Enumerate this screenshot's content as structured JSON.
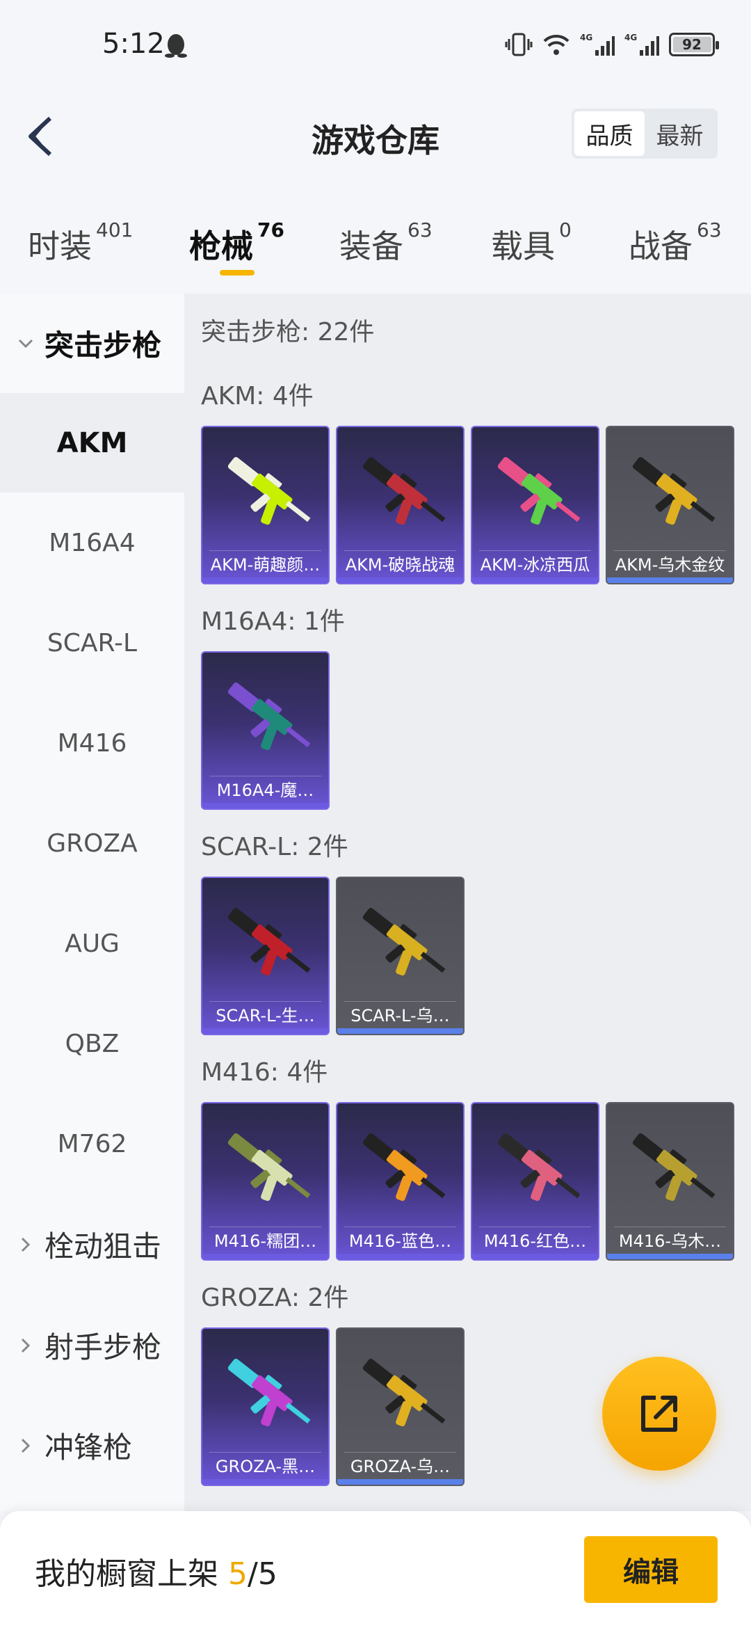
{
  "status": {
    "time": "5:12",
    "battery": "92"
  },
  "header": {
    "title": "游戏仓库",
    "sort_options": [
      "品质",
      "最新"
    ],
    "sort_active": "品质"
  },
  "tabs": [
    {
      "label": "时装",
      "count": "401"
    },
    {
      "label": "枪械",
      "count": "76"
    },
    {
      "label": "装备",
      "count": "63"
    },
    {
      "label": "载具",
      "count": "0"
    },
    {
      "label": "战备",
      "count": "63"
    }
  ],
  "sidebar": {
    "open_group": "突击步枪",
    "items": [
      "AKM",
      "M16A4",
      "SCAR-L",
      "M416",
      "GROZA",
      "AUG",
      "QBZ",
      "M762"
    ],
    "active_item": "AKM",
    "collapsed_groups": [
      "栓动狙击",
      "射手步枪",
      "冲锋枪"
    ]
  },
  "main": {
    "category_total": "突击步枪: 22件",
    "sections": [
      {
        "title": "AKM: 4件",
        "items": [
          {
            "label": "AKM-萌趣颜…",
            "quality": "purple",
            "colors": [
              "#c6f000",
              "#f0f0e0"
            ]
          },
          {
            "label": "AKM-破晓战魂",
            "quality": "purple",
            "colors": [
              "#c0303a",
              "#222"
            ]
          },
          {
            "label": "AKM-冰凉西瓜",
            "quality": "purple",
            "colors": [
              "#5ed04a",
              "#e8508a"
            ]
          },
          {
            "label": "AKM-乌木金纹",
            "quality": "gray",
            "colors": [
              "#e0b020",
              "#222"
            ]
          }
        ]
      },
      {
        "title": "M16A4: 1件",
        "items": [
          {
            "label": "M16A4-魔…",
            "quality": "purple",
            "colors": [
              "#1f8a7a",
              "#7a4fd0"
            ]
          }
        ]
      },
      {
        "title": "SCAR-L: 2件",
        "items": [
          {
            "label": "SCAR-L-生…",
            "quality": "purple",
            "colors": [
              "#c0202a",
              "#222"
            ]
          },
          {
            "label": "SCAR-L-乌…",
            "quality": "gray",
            "colors": [
              "#d8b020",
              "#222"
            ]
          }
        ]
      },
      {
        "title": "M416: 4件",
        "items": [
          {
            "label": "M416-糯团…",
            "quality": "purple",
            "colors": [
              "#d8e0b0",
              "#7a8a40"
            ]
          },
          {
            "label": "M416-蓝色…",
            "quality": "purple",
            "colors": [
              "#f09a20",
              "#222"
            ]
          },
          {
            "label": "M416-红色…",
            "quality": "purple",
            "colors": [
              "#e06080",
              "#2a2a2a"
            ]
          },
          {
            "label": "M416-乌木…",
            "quality": "gray",
            "colors": [
              "#b8a030",
              "#222"
            ]
          }
        ]
      },
      {
        "title": "GROZA: 2件",
        "items": [
          {
            "label": "GROZA-黑…",
            "quality": "purple",
            "colors": [
              "#c040d0",
              "#40d0e0"
            ]
          },
          {
            "label": "GROZA-乌…",
            "quality": "gray",
            "colors": [
              "#e0b020",
              "#222"
            ]
          }
        ]
      }
    ]
  },
  "bottom": {
    "shelf_label": "我的橱窗上架",
    "shelf_current": "5",
    "shelf_total": "/5",
    "edit_label": "编辑"
  },
  "colors": {
    "accent": "#f7b500",
    "purple_quality": "#6a55d6",
    "gray_quality": "#5a80ea"
  }
}
